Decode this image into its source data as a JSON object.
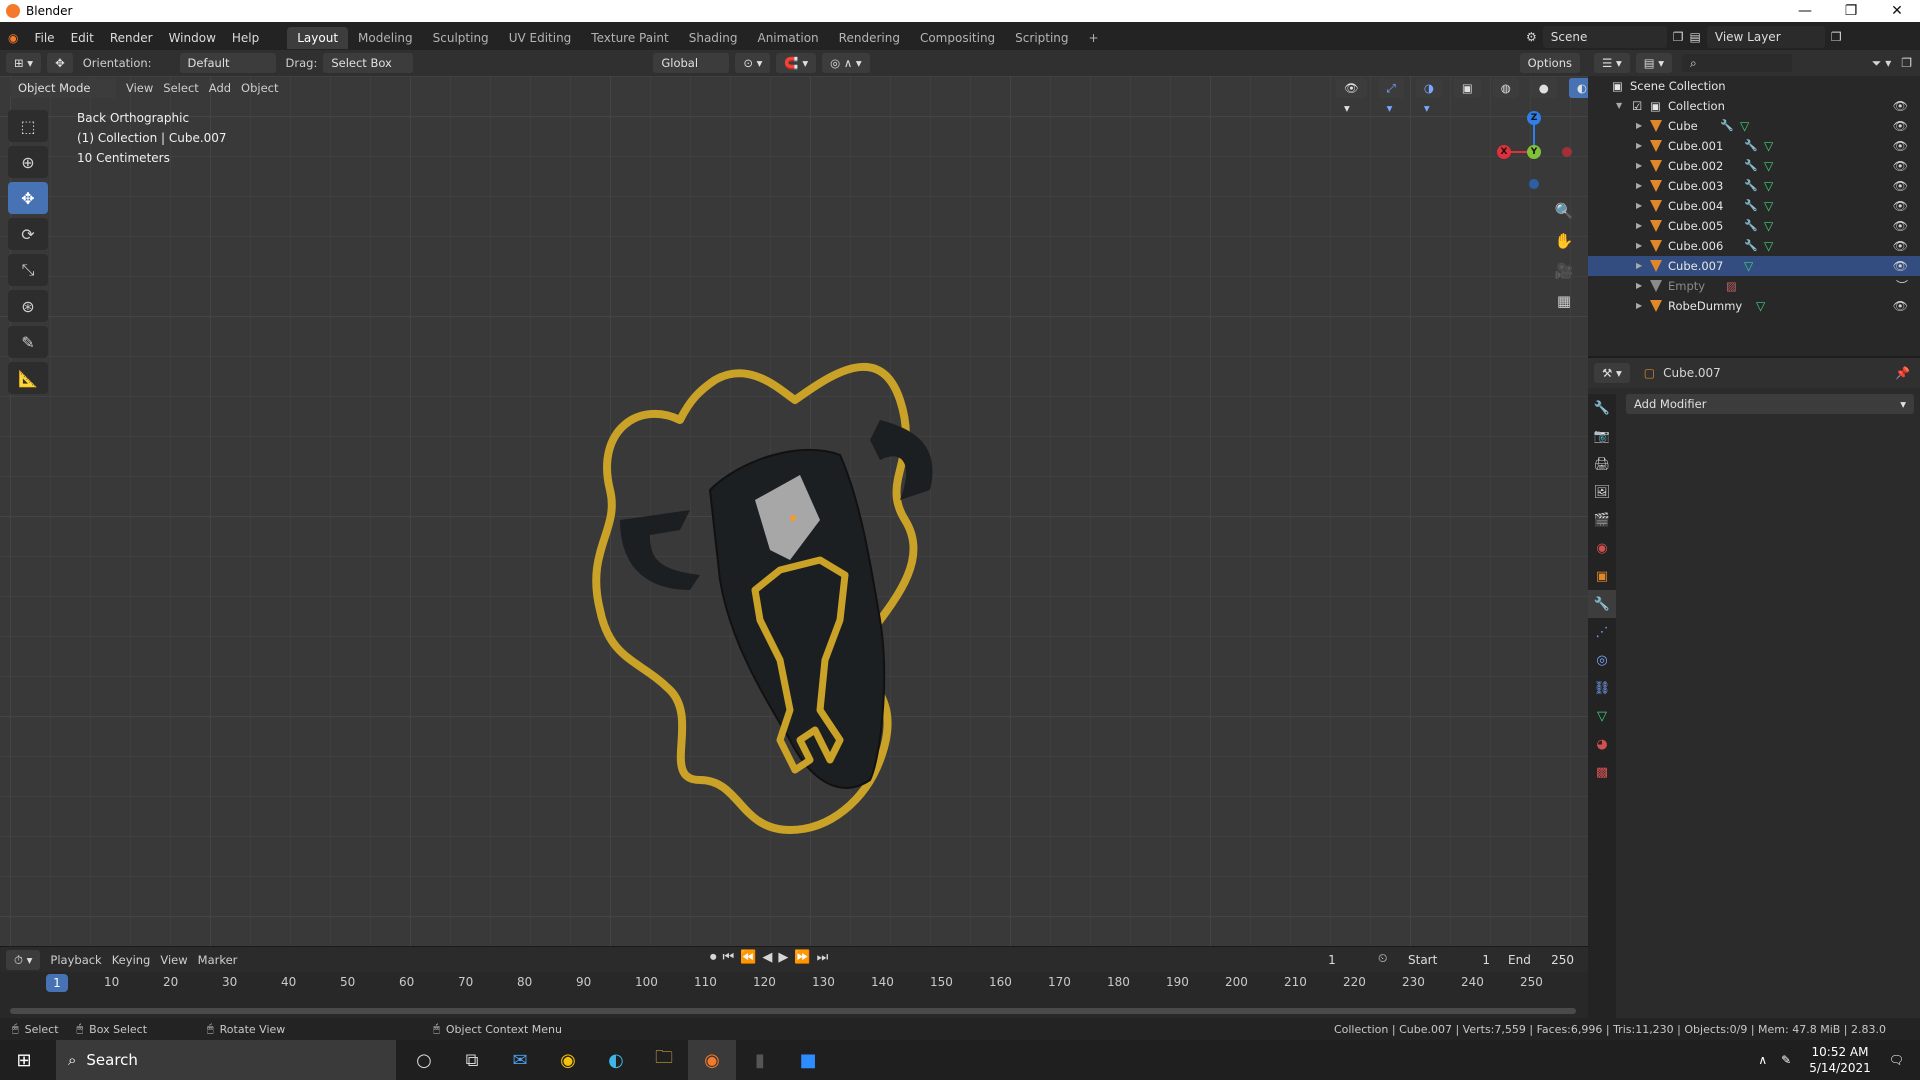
{
  "window": {
    "title": "Blender",
    "controls": [
      "—",
      "❐",
      "✕"
    ]
  },
  "menu": [
    "File",
    "Edit",
    "Render",
    "Window",
    "Help"
  ],
  "workspaces": [
    "Layout",
    "Modeling",
    "Sculpting",
    "UV Editing",
    "Texture Paint",
    "Shading",
    "Animation",
    "Rendering",
    "Compositing",
    "Scripting",
    "+"
  ],
  "scene": "Scene",
  "view_layer": "View Layer",
  "viewport_header": {
    "orientation_label": "Orientation:",
    "orientation_value": "Default",
    "drag_label": "Drag:",
    "drag_value": "Select Box",
    "transform_space": "Global",
    "options": "Options"
  },
  "viewport_row2": {
    "mode": "Object Mode",
    "menus": [
      "View",
      "Select",
      "Add",
      "Object"
    ]
  },
  "overlay": {
    "view_name": "Back Orthographic",
    "collection_info": "(1) Collection | Cube.007",
    "scale": "10 Centimeters"
  },
  "gizmo": {
    "z": "Z",
    "y": "Y",
    "x": "X"
  },
  "timeline": {
    "menus": [
      "Playback",
      "Keying",
      "View",
      "Marker"
    ],
    "current_frame": "1",
    "start_label": "Start",
    "start_value": "1",
    "end_label": "End",
    "end_value": "250",
    "ticks": [
      "10",
      "20",
      "30",
      "40",
      "50",
      "60",
      "70",
      "80",
      "90",
      "100",
      "110",
      "120",
      "130",
      "140",
      "150",
      "160",
      "170",
      "180",
      "190",
      "200",
      "210",
      "220",
      "230",
      "240",
      "250"
    ],
    "marker": "1"
  },
  "outliner": {
    "root": "Scene Collection",
    "collection": "Collection",
    "items": [
      "Cube",
      "Cube.001",
      "Cube.002",
      "Cube.003",
      "Cube.004",
      "Cube.005",
      "Cube.006",
      "Cube.007",
      "Empty",
      "RobeDummy"
    ],
    "selected": "Cube.007"
  },
  "properties": {
    "object": "Cube.007",
    "add_modifier": "Add Modifier"
  },
  "status": {
    "select": "Select",
    "box_select": "Box Select",
    "rotate_view": "Rotate View",
    "context_menu": "Object Context Menu",
    "stats": "Collection | Cube.007 | Verts:7,559 | Faces:6,996 | Tris:11,230 | Objects:0/9 | Mem: 47.8 MiB | 2.83.0"
  },
  "taskbar": {
    "search": "Search",
    "time": "10:52 AM",
    "date": "5/14/2021"
  },
  "colors": {
    "accent": "#4772b3",
    "selection": "#334d80",
    "gold": "#c9a227",
    "mask": "#1c1f22"
  }
}
